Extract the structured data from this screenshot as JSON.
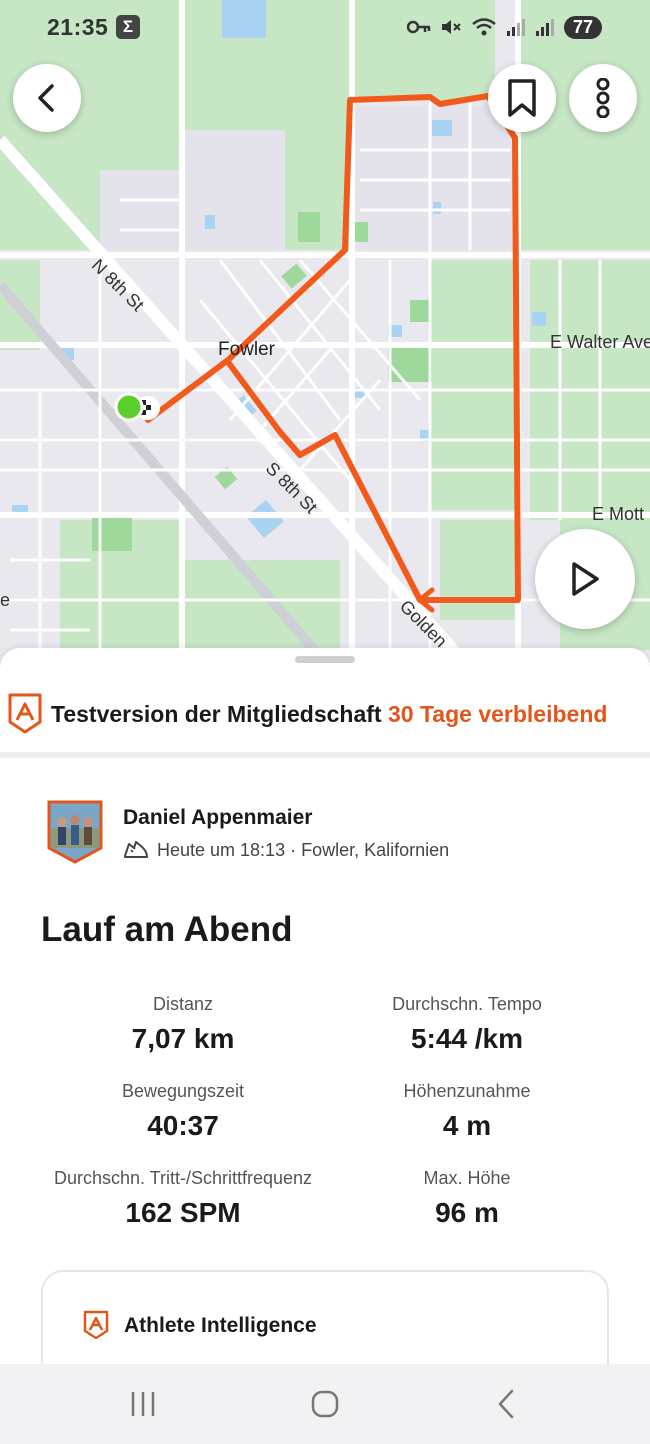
{
  "status_bar": {
    "time": "21:35",
    "app_icon_glyph": "Σ",
    "battery": "77",
    "icons": [
      "key-icon",
      "mute-icon",
      "wifi-icon",
      "signal-icon",
      "signal-icon"
    ]
  },
  "map": {
    "labels": {
      "n8th": "N 8th St",
      "s8th": "S 8th St",
      "town": "Fowler",
      "walter": "E Walter Ave",
      "mott": "E Mott",
      "golden": "Golden",
      "edge_e": "e"
    },
    "route_color": "#f15a1a",
    "start_color": "#5ccf2e"
  },
  "trial": {
    "label": "Testversion der Mitgliedschaft",
    "remaining": "30 Tage verbleibend",
    "accent": "#e2561c"
  },
  "athlete": {
    "name": "Daniel Appenmaier",
    "meta": "Heute um 18:13 · Fowler, Kalifornien"
  },
  "activity": {
    "title": "Lauf am Abend",
    "stats": [
      {
        "label": "Distanz",
        "value": "7,07 km"
      },
      {
        "label": "Durchschn. Tempo",
        "value": "5:44 /km"
      },
      {
        "label": "Bewegungszeit",
        "value": "40:37"
      },
      {
        "label": "Höhenzunahme",
        "value": "4 m"
      },
      {
        "label": "Durchschn. Tritt-/Schrittfrequenz",
        "value": "162 SPM"
      },
      {
        "label": "Max. Höhe",
        "value": "96 m"
      }
    ]
  },
  "ai_card": {
    "title": "Athlete Intelligence"
  },
  "nav": {
    "icons": [
      "recents-icon",
      "home-icon",
      "back-nav-icon"
    ]
  }
}
